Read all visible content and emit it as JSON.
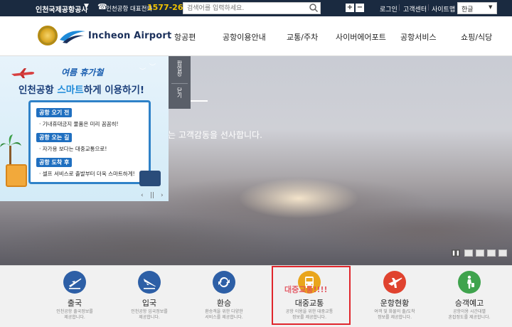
{
  "topbar": {
    "org_name": "인천국제공항공사",
    "org_arrow": "▼",
    "phone_label": "인천공항 대표전화",
    "phone_number": "1577-2600",
    "search_placeholder": "검색어를 입력하세요.",
    "zoom_in": "+",
    "zoom_out": "−",
    "login": "로그인",
    "customer_center": "고객센터",
    "sitemap": "사이트맵",
    "language": "한글",
    "colors": {
      "bg": "#1a2a40",
      "accent": "#f2c200"
    }
  },
  "header": {
    "logo_text": "Incheon Airport",
    "nav": [
      "항공편",
      "공항이용안내",
      "교통/주차",
      "사이버에어포트",
      "공항서비스",
      "쇼핑/식당"
    ]
  },
  "hero": {
    "heading": "가",
    "subtitle": "는 고객감동을 선사합니다."
  },
  "popup": {
    "close_label_top": "팝업창",
    "close_label_bottom": "닫기",
    "title_line1": "여름 휴가철",
    "title_line2_pre": "인천공항 ",
    "title_line2_highlight": "스마트",
    "title_line2_post": "하게 이용하기!",
    "sections": [
      {
        "pill": "공항 오기 전",
        "line": "· 기내휴대금지 물품은 미리 꼼꼼히!"
      },
      {
        "pill": "공항 오는 길",
        "line": "· 자가용 보다는 대중교통으로!"
      },
      {
        "pill": "공항 도착 후",
        "line": "· 셀프 서비스로 출발부터 더욱 스마트하게!"
      }
    ],
    "pager": {
      "prev": "‹",
      "pause": "||",
      "next": "›"
    }
  },
  "quick_menu": [
    {
      "label": "출국",
      "desc_line1": "인천공항 출국정보를",
      "desc_line2": "제공합니다.",
      "color": "#2d5fa6",
      "icon": "departure-plane-icon"
    },
    {
      "label": "입국",
      "desc_line1": "인천공항 입국정보를",
      "desc_line2": "제공합니다.",
      "color": "#2d5fa6",
      "icon": "arrival-plane-icon"
    },
    {
      "label": "환승",
      "desc_line1": "환승객을 위한 다양한",
      "desc_line2": "서비스를 제공합니다.",
      "color": "#2d5fa6",
      "icon": "transfer-icon"
    },
    {
      "label": "대중교통",
      "desc_line1": "공항 이용을 위한 대중교통",
      "desc_line2": "정보를 제공합니다.",
      "color": "#e9a51c",
      "icon": "bus-icon"
    },
    {
      "label": "운항현황",
      "desc_line1": "여객 및 화물의 출/도착",
      "desc_line2": "정보를 제공합니다.",
      "color": "#e0432f",
      "icon": "flight-status-icon"
    },
    {
      "label": "승객예고",
      "desc_line1": "공항이용 시간대별",
      "desc_line2": "혼잡정도를 제공합니다.",
      "color": "#3fa34d",
      "icon": "passenger-icon"
    }
  ],
  "annotation": {
    "note": "대중교통!!!!",
    "color": "#e0262c"
  }
}
